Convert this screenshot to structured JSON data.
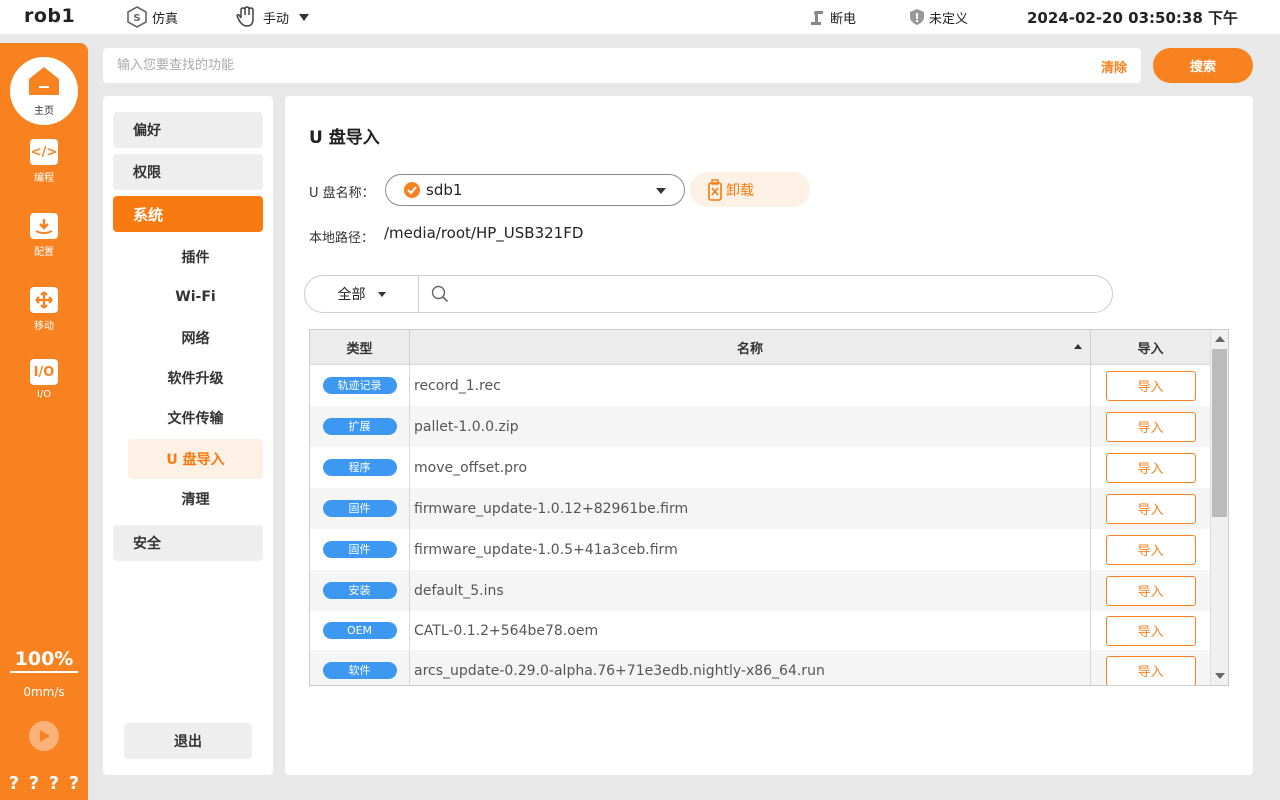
{
  "topbar": {
    "robot_name": "rob1",
    "mode_sim": "仿真",
    "mode_manual": "手动",
    "power": "断电",
    "safety": "未定义",
    "datetime": "2024-02-20 03:50:38 下午"
  },
  "leftnav": {
    "home": "主页",
    "items": [
      {
        "label": "编程",
        "icon": "code-icon"
      },
      {
        "label": "配置",
        "icon": "config-icon"
      },
      {
        "label": "移动",
        "icon": "move-icon"
      },
      {
        "label": "I/O",
        "icon": "io-icon"
      }
    ],
    "speed_percent": "100%",
    "speed_value": "0mm/s",
    "help": [
      "?",
      "?",
      "?",
      "?"
    ]
  },
  "search": {
    "placeholder": "输入您要查找的功能",
    "clear_label": "清除",
    "search_label": "搜索"
  },
  "settings_nav": {
    "sections": [
      "偏好",
      "权限",
      "系统",
      "安全"
    ],
    "system_items": [
      "插件",
      "Wi-Fi",
      "网络",
      "软件升级",
      "文件传输",
      "U 盘导入",
      "清理"
    ],
    "logout": "退出"
  },
  "main": {
    "title": "U 盘导入",
    "usb_name_label": "U 盘名称：",
    "usb_name_value": "sdb1",
    "unmount_label": "卸载",
    "local_path_label": "本地路径：",
    "local_path_value": "/media/root/HP_USB321FD",
    "filter_type": "全部",
    "filter_placeholder": "",
    "table": {
      "headers": {
        "type": "类型",
        "name": "名称",
        "action": "导入"
      },
      "import_label": "导入",
      "rows": [
        {
          "type": "轨迹记录",
          "name": "record_1.rec"
        },
        {
          "type": "扩展",
          "name": "pallet-1.0.0.zip"
        },
        {
          "type": "程序",
          "name": "move_offset.pro"
        },
        {
          "type": "固件",
          "name": "firmware_update-1.0.12+82961be.firm"
        },
        {
          "type": "固件",
          "name": "firmware_update-1.0.5+41a3ceb.firm"
        },
        {
          "type": "安装",
          "name": "default_5.ins"
        },
        {
          "type": "OEM",
          "name": "CATL-0.1.2+564be78.oem"
        },
        {
          "type": "软件",
          "name": "arcs_update-0.29.0-alpha.76+71e3edb.nightly-x86_64.run"
        }
      ]
    }
  },
  "colors": {
    "accent": "#f98220",
    "badge": "#3d98f2",
    "active_bg": "#fdf0e4"
  }
}
